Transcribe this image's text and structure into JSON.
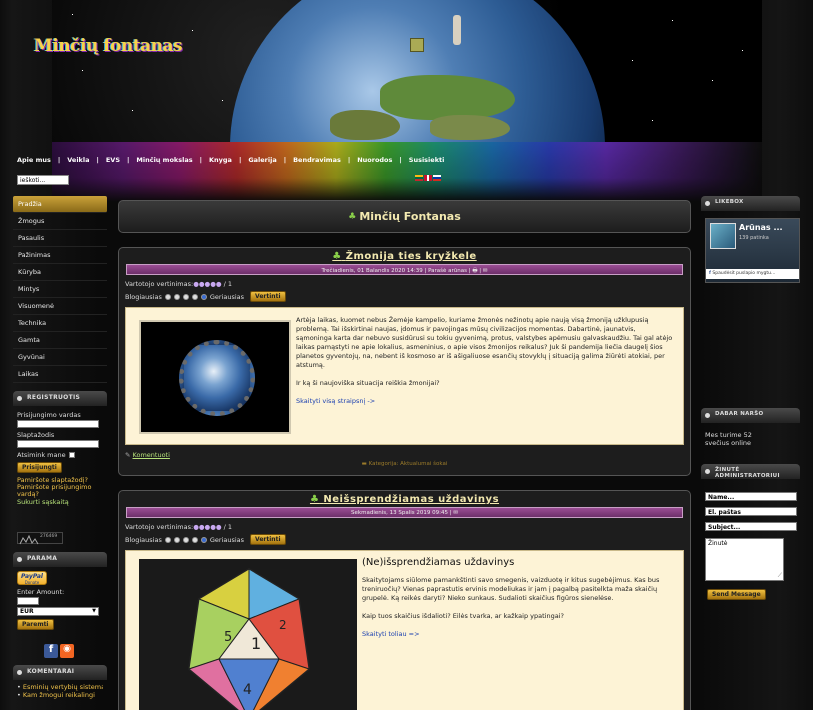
{
  "site": {
    "logo": "Minčių fontanas"
  },
  "topnav": [
    "Apie mus",
    "Veikla",
    "EVS",
    "Minčių mokslas",
    "Knyga",
    "Galerija",
    "Bendravimas",
    "Nuorodos",
    "Susisiekti"
  ],
  "search": {
    "value": "ieškoti..."
  },
  "left_menu": [
    "Pradžia",
    "Žmogus",
    "Pasaulis",
    "Pažinimas",
    "Kūryba",
    "Mintys",
    "Visuomenė",
    "Technika",
    "Gamta",
    "Gyvūnai",
    "Laikas"
  ],
  "login": {
    "heading": "Registruotis",
    "username_label": "Prisijungimo vardas",
    "password_label": "Slaptažodis",
    "remember_label": "Atsimink mane",
    "submit": "Prisijungti",
    "forgot_password": "Pamiršote slaptažodį?",
    "forgot_username": "Pamiršote prisijungimo vardą?",
    "create_account": "Sukurti sąskaitą"
  },
  "counter": {
    "value": "276469"
  },
  "support": {
    "heading": "Parama",
    "paypal": "PayPal",
    "paypal_sub": "Donate",
    "amount_label": "Enter Amount:",
    "currency": "EUR",
    "submit": "Paremti"
  },
  "comments": {
    "heading": "Komentarai",
    "items": [
      "Esminių vertybių sistema (3)",
      "Kam žmogui reikalingi"
    ]
  },
  "page_title": "Minčių Fontanas",
  "articles": [
    {
      "title": "Žmonija ties kryžkele",
      "meta": "Trečiadienis, 01 Balandis 2020 14:39 | Parašė arūnas | ",
      "rating_label": "Vartotojo vertinimas:",
      "rating_count": "/ 1",
      "vote_worst": "Blogiausias",
      "vote_best": "Geriausias",
      "vote_button": "Vertinti",
      "subtitle": "",
      "paragraphs": [
        "Artėja laikas, kuomet nebus Žemėje kampelio, kuriame žmonės nežinotų apie naują visą žmoniją užklupusią problemą. Tai išskirtinai naujas, įdomus ir pavojingas mūsų civilizacijos momentas. Dabartinė, jaunatvis, sąmoninga karta dar nebuvo susidūrusi su tokiu gyvenimą, protus, valstybes apėmusiu galvaskaudžiu. Tai gal atėjo laikas pamąstyti ne apie lokalius, asmeninius, o apie visos žmonijos reikalus? Juk ši pandemija liečia daugelį šios planetos gyventojų, na, nebent iš kosmoso ar iš ašigaliuose esančių stovyklų į situaciją galima žiūrėti atokiai, per atstumą.",
        "Ir ką ši naujoviška situacija reiškia žmonijai?"
      ],
      "readmore": "Skaityti visą straipsnį ->",
      "comment_link": "Komentuoti",
      "category": "Kategorija: Aktualumai šokai"
    },
    {
      "title": "Neišsprendžiamas uždavinys",
      "meta": "Sekmadienis, 13 Spalis 2019 09:45 | ",
      "rating_label": "Vartotojo vertinimas:",
      "rating_count": "/ 1",
      "vote_worst": "Blogiausias",
      "vote_best": "Geriausias",
      "vote_button": "Vertinti",
      "subtitle": "(Ne)išsprendžiamas uždavinys",
      "paragraphs": [
        "Skaitytojams siūlome pamankštinti savo smegenis, vaizduotę ir kitus sugebėjimus. Kas bus treniruočių? Vienas paprastutis ervinis modeliukas ir jam į pagalbą pasitelkta maža skaičių grupelė. Ką reikės daryti? Nieko sunkaus. Sudalioti skaičius figūros sienelėse.",
        "Kaip tuos skaičius išdalioti? Eilės tvarka, ar kažkaip ypatingai?"
      ],
      "readmore": "Skaityti toliau =>"
    }
  ],
  "likebox": {
    "heading": "Likebox",
    "page_name": "Arūnas ...",
    "likes": "139 patinka",
    "social_plugin": "Spaudėsit puslapio mygtu..."
  },
  "online": {
    "heading": "Dabar naršo",
    "text": "Mes turime 52 svečius online"
  },
  "contact": {
    "heading": "Žinutė administratoriui",
    "name_placeholder": "Name...",
    "email_placeholder": "El. paštas",
    "subject_placeholder": "Subject...",
    "message_placeholder": "Žinutė",
    "submit": "Send Message"
  }
}
